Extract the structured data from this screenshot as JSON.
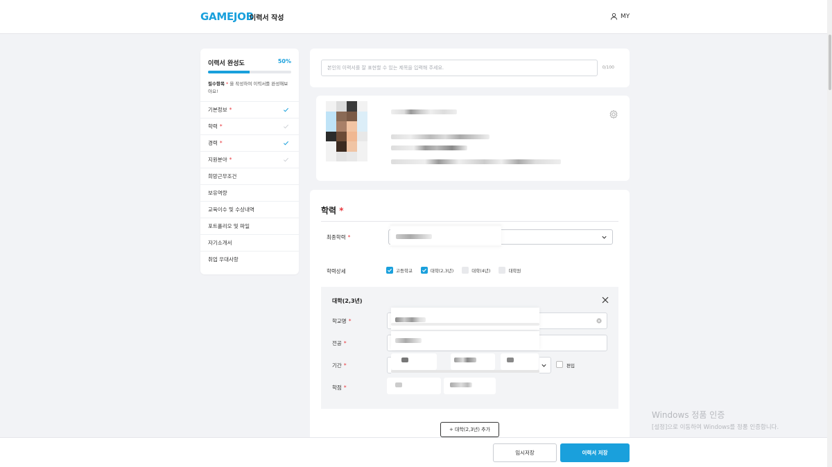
{
  "header": {
    "logo": "GAMEJOB",
    "title": "이력서 작성",
    "my_label": "MY"
  },
  "colors": {
    "accent": "#1aa0dc",
    "required": "#e8383d"
  },
  "sidebar": {
    "title": "이력서 완성도",
    "percent_label": "50%",
    "progress": 0.5,
    "note_bold": "필수항목",
    "note_star": "*",
    "note_rest": "을 작성하여 이력서를 완성해보아요!",
    "items": [
      {
        "label": "기본정보",
        "required": "*",
        "icon": "check-icon",
        "done": true
      },
      {
        "label": "학력",
        "required": "*",
        "icon": "check-icon",
        "done": false
      },
      {
        "label": "경력",
        "required": "*",
        "icon": "check-icon",
        "done": true
      },
      {
        "label": "지원분야",
        "required": "*",
        "icon": "check-icon",
        "done": false
      },
      {
        "label": "희망근무조건",
        "required": ""
      },
      {
        "label": "보유역량",
        "required": ""
      },
      {
        "label": "교육이수 및 수상내역",
        "required": ""
      },
      {
        "label": "포트폴리오 및 파일",
        "required": ""
      },
      {
        "label": "자기소개서",
        "required": ""
      },
      {
        "label": "취업 우대사항",
        "required": ""
      }
    ]
  },
  "resume_title": {
    "placeholder": "본인의 이력서를 잘 표현할 수 있는 제목을 입력해 주세요.",
    "counter": "0/100"
  },
  "education": {
    "heading": "학력",
    "required": "*",
    "final_label": "최종학력",
    "detail_label": "학력상세",
    "options": [
      {
        "label": "고등학교",
        "checked": true
      },
      {
        "label": "대학(2,3년)",
        "checked": true
      },
      {
        "label": "대학(4년)",
        "checked": false
      },
      {
        "label": "대학원",
        "checked": false
      }
    ],
    "panel": {
      "title": "대학(2,3년)",
      "school_label": "학교명",
      "major_label": "전공",
      "period_label": "기간",
      "transfer_label": "편입",
      "gpa_label": "학점"
    },
    "add_button": "+ 대학(2,3년) 추가"
  },
  "footer": {
    "temp_save": "임시저장",
    "save": "이력서 저장"
  },
  "watermark": {
    "line1": "Windows 정품 인증",
    "line2": "[설정]으로 이동하여 Windows를 정품 인증합니다."
  }
}
